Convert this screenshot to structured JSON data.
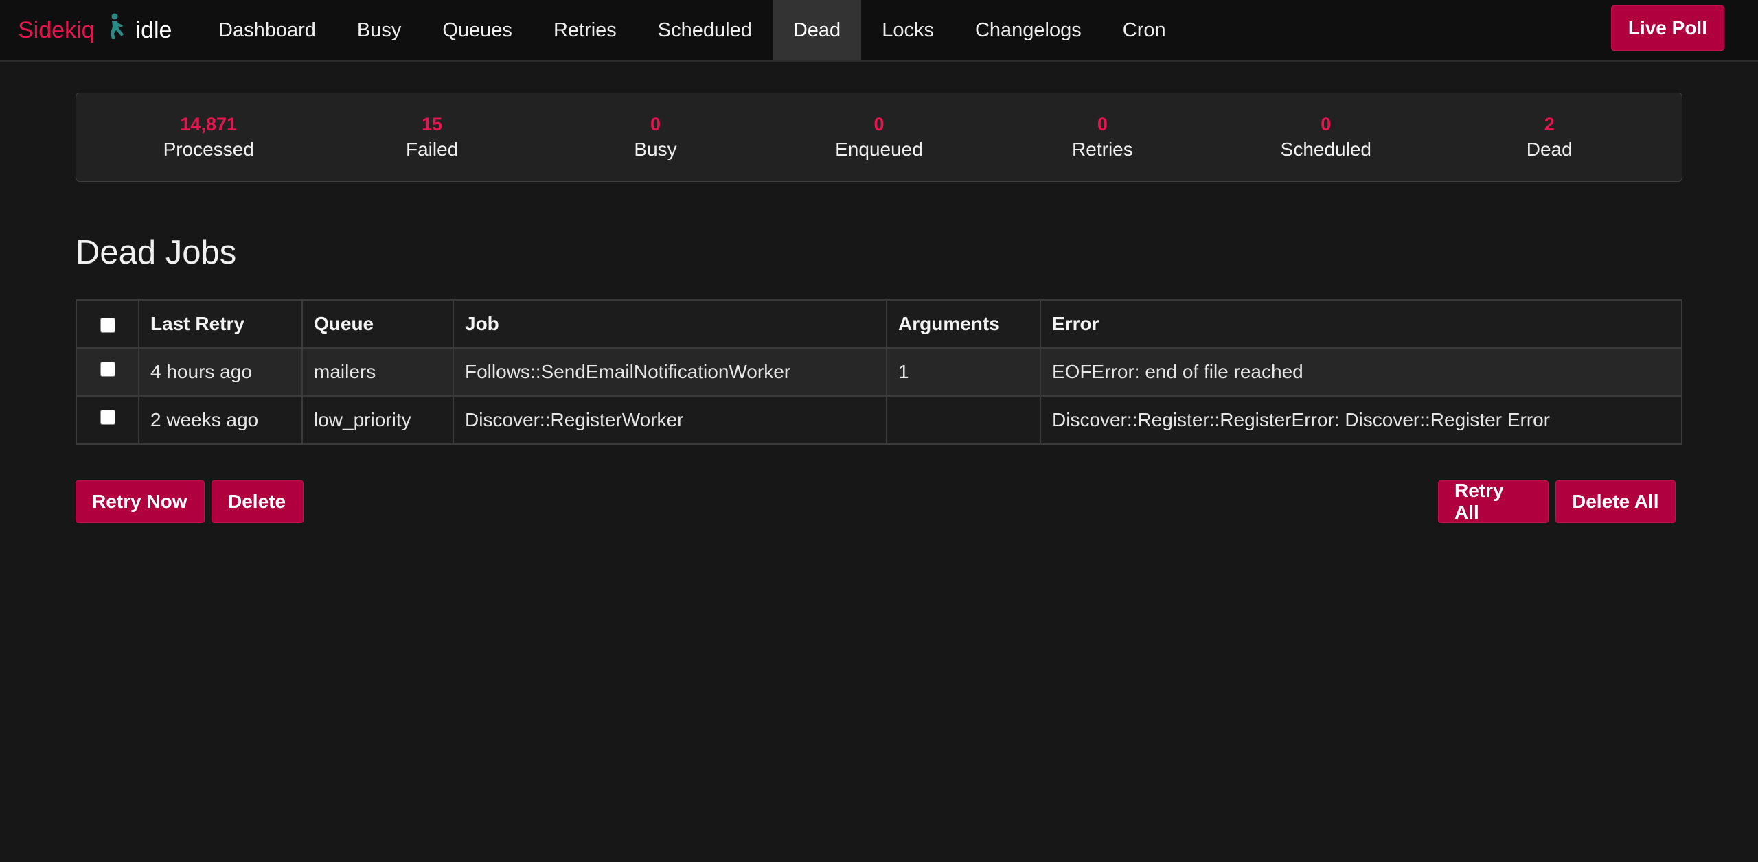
{
  "brand": {
    "name": "Sidekiq",
    "status": "idle",
    "logo_icon": "sidekiq-kicker-logo-icon",
    "accent_color": "#e8144f",
    "logo_color": "#2a8a86"
  },
  "nav": {
    "items": [
      {
        "label": "Dashboard",
        "active": false
      },
      {
        "label": "Busy",
        "active": false
      },
      {
        "label": "Queues",
        "active": false
      },
      {
        "label": "Retries",
        "active": false
      },
      {
        "label": "Scheduled",
        "active": false
      },
      {
        "label": "Dead",
        "active": true
      },
      {
        "label": "Locks",
        "active": false
      },
      {
        "label": "Changelogs",
        "active": false
      },
      {
        "label": "Cron",
        "active": false
      }
    ],
    "live_poll_label": "Live Poll"
  },
  "stats": [
    {
      "count": "14,871",
      "label": "Processed"
    },
    {
      "count": "15",
      "label": "Failed"
    },
    {
      "count": "0",
      "label": "Busy"
    },
    {
      "count": "0",
      "label": "Enqueued"
    },
    {
      "count": "0",
      "label": "Retries"
    },
    {
      "count": "0",
      "label": "Scheduled"
    },
    {
      "count": "2",
      "label": "Dead"
    }
  ],
  "page": {
    "title": "Dead Jobs"
  },
  "table": {
    "headers": {
      "last_retry": "Last Retry",
      "queue": "Queue",
      "job": "Job",
      "arguments": "Arguments",
      "error": "Error"
    },
    "select_all_checked": false,
    "rows": [
      {
        "checked": false,
        "last_retry": "4 hours ago",
        "queue": "mailers",
        "job": "Follows::SendEmailNotificationWorker",
        "arguments": "1",
        "error": "EOFError: end of file reached"
      },
      {
        "checked": false,
        "last_retry": "2 weeks ago",
        "queue": "low_priority",
        "job": "Discover::RegisterWorker",
        "arguments": "",
        "error": "Discover::Register::RegisterError: Discover::Register Error"
      }
    ]
  },
  "actions": {
    "retry_now": "Retry Now",
    "delete": "Delete",
    "retry_all": "Retry All",
    "delete_all": "Delete All"
  },
  "colors": {
    "background": "#171717",
    "navbar": "#0f0f0f",
    "button": "#b1003e"
  }
}
